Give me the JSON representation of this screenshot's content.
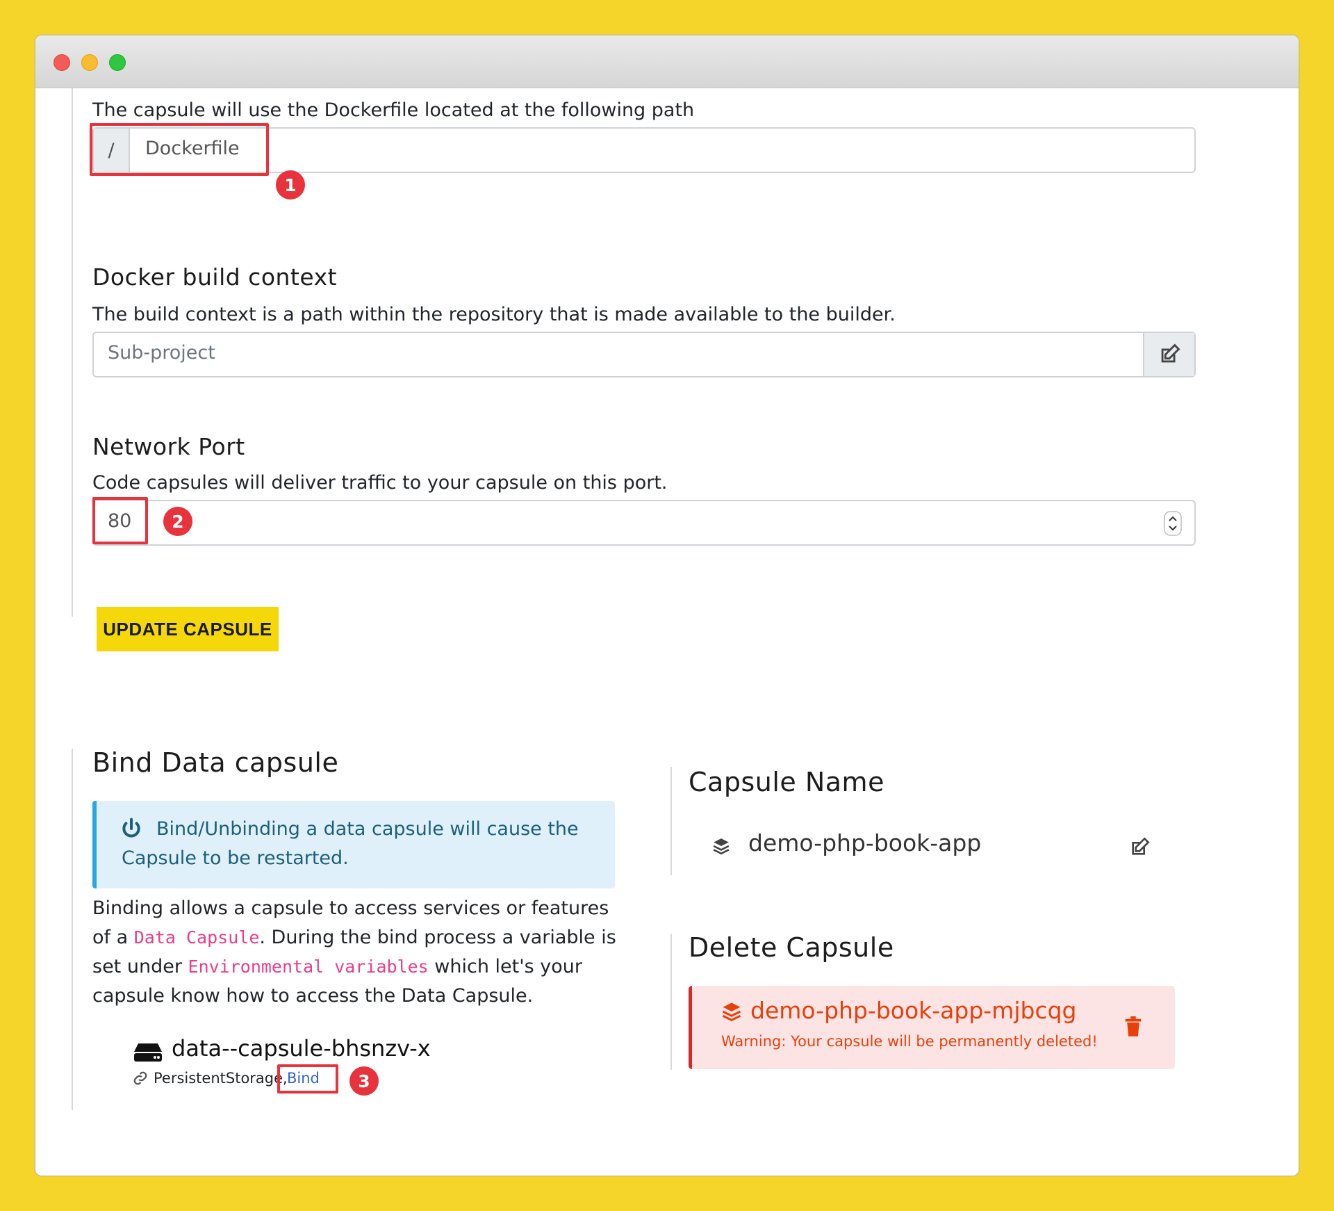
{
  "dockerfile": {
    "description": "The capsule will use the Dockerfile located at the following path",
    "prefix": "/",
    "value": "Dockerfile",
    "badge": "1"
  },
  "build_context": {
    "title": "Docker build context",
    "description": "The build context is a path within the repository that is made available to the builder.",
    "placeholder": "Sub-project",
    "edit_icon": "edit-icon"
  },
  "network_port": {
    "title": "Network Port",
    "description": "Code capsules will deliver traffic to your capsule on this port.",
    "value": "80",
    "badge": "2"
  },
  "update_button": {
    "label": "UPDATE CAPSULE"
  },
  "bind": {
    "title": "Bind Data capsule",
    "info": "Bind/Unbinding a data capsule will cause the Capsule to be restarted.",
    "para_1": "Binding allows a capsule to access services or features of a ",
    "code_1": "Data Capsule",
    "para_2": ". During the bind process a variable is set under ",
    "code_2": "Environmental variables",
    "para_3": " which let's your capsule know how to access the Data Capsule.",
    "item_name": "data--capsule-bhsnzv-x",
    "item_type": "PersistentStorage,",
    "item_action": "Bind",
    "badge": "3"
  },
  "capsule_name": {
    "title": "Capsule Name",
    "value": "demo-php-book-app"
  },
  "delete_capsule": {
    "title": "Delete Capsule",
    "name": "demo-php-book-app-mjbcqg",
    "warning": "Warning: Your capsule will be permanently deleted!"
  },
  "colors": {
    "page_bg": "#f5d52a",
    "accent_yellow": "#f5d80a",
    "highlight_red": "#e8323c",
    "danger_text": "#e8400c",
    "info_bg": "#dff0fb",
    "info_border": "#29a6e5",
    "link_blue": "#2f63d8"
  }
}
